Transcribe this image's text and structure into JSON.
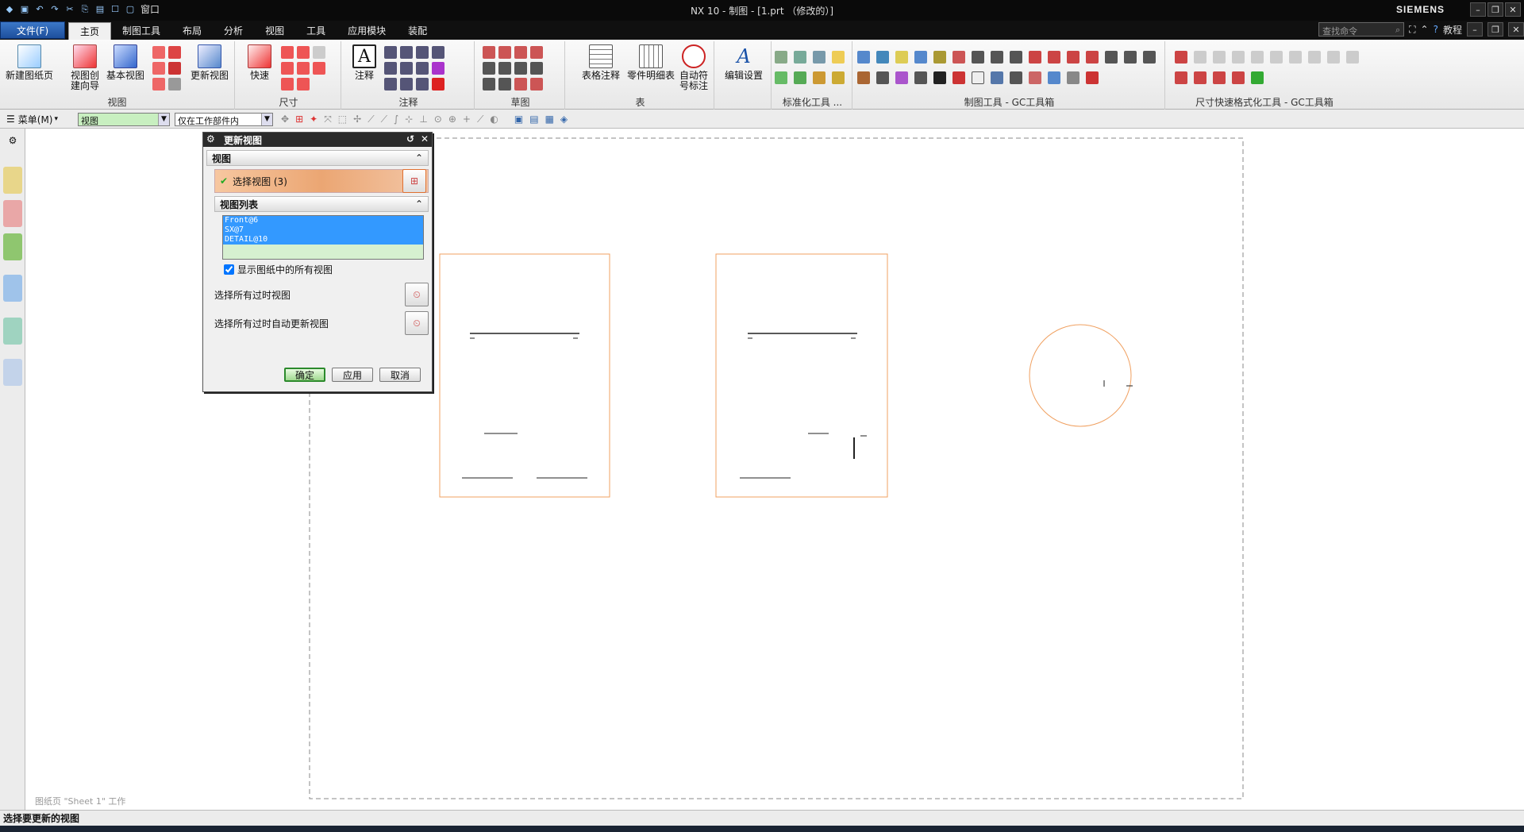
{
  "window": {
    "title": "NX 10 - 制图 - [1.prt （修改的）]",
    "brand": "SIEMENS",
    "quick_access": {
      "window_menu_label": "窗口"
    }
  },
  "tabs": {
    "file_label": "文件(F)",
    "items": [
      "主页",
      "制图工具",
      "布局",
      "分析",
      "视图",
      "工具",
      "应用模块",
      "装配"
    ],
    "active": "主页",
    "search_placeholder": "查找命令",
    "help_label": "教程"
  },
  "ribbon": {
    "view_group": {
      "label": "视图",
      "buttons": [
        "新建图纸页",
        "视图创建向导",
        "基本视图",
        "更新视图"
      ]
    },
    "dimension_group": {
      "label": "尺寸",
      "buttons": [
        "快速"
      ]
    },
    "annotation_group": {
      "label": "注释",
      "buttons": [
        "注释"
      ]
    },
    "sketch_group": {
      "label": "草图"
    },
    "table_group": {
      "label": "表",
      "buttons": [
        "表格注释",
        "零件明细表",
        "自动符号标注"
      ]
    },
    "settings_button": "编辑设置",
    "standard_tools_label": "标准化工具 ...",
    "drafting_tools_label": "制图工具 - GC工具箱",
    "dim_format_label": "尺寸快速格式化工具 - GC工具箱"
  },
  "toolbar2": {
    "menu_label": "菜单(M)",
    "filter_value": "视图",
    "scope_value": "仅在工作部件内"
  },
  "dialog": {
    "title": "更新视图",
    "section_view": "视图",
    "select_view_label": "选择视图 (3)",
    "list_section": "视图列表",
    "list_items": [
      "Front@6",
      "SX@7",
      "DETAIL@10"
    ],
    "show_all_label": "显示图纸中的所有视图",
    "show_all_checked": true,
    "select_outdated_label": "选择所有过时视图",
    "select_outdated_auto_label": "选择所有过时自动更新视图",
    "ok_label": "确定",
    "apply_label": "应用",
    "cancel_label": "取消"
  },
  "sheet_status": "图纸页 \"Sheet 1\" 工作",
  "status_message": "选择要更新的视图",
  "colors": {
    "view_border": "#f0a060",
    "accent": "#1d4f9c"
  }
}
